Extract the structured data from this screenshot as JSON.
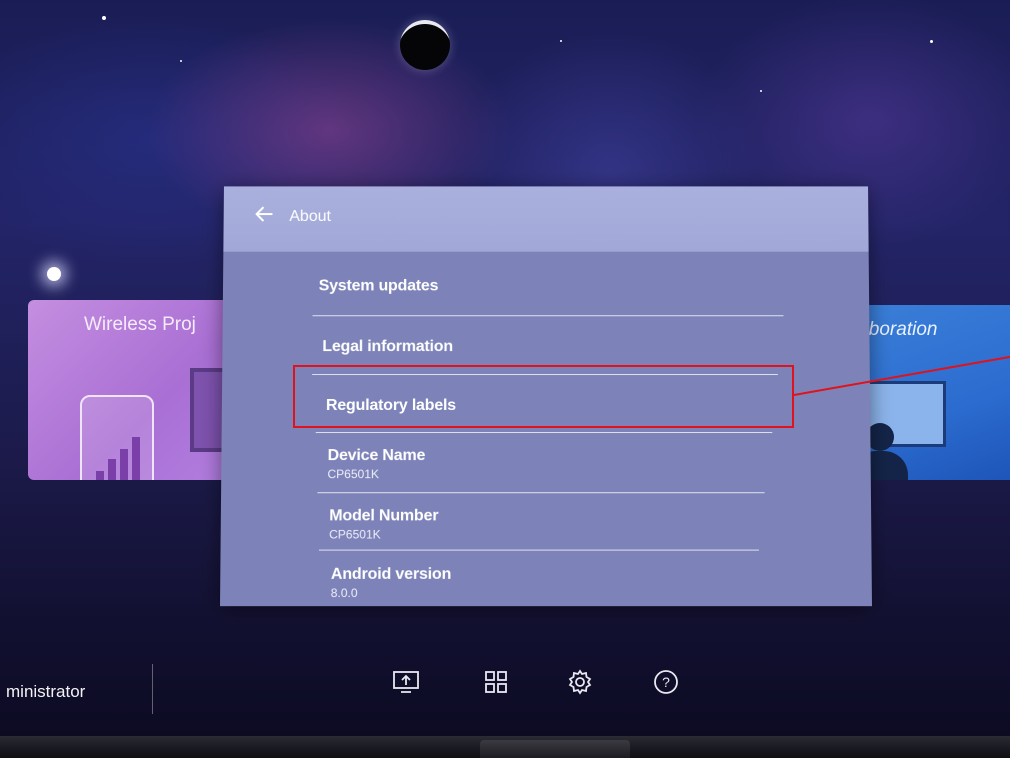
{
  "background_cards": {
    "left_title": "Wireless Proj",
    "right_title": "laboration"
  },
  "dialog": {
    "back_icon": "arrow-left-icon",
    "title": "About",
    "items": [
      {
        "label": "System updates",
        "value": ""
      },
      {
        "label": "Legal information",
        "value": ""
      },
      {
        "label": "Regulatory labels",
        "value": ""
      },
      {
        "label": "Device Name",
        "value": "CP6501K"
      },
      {
        "label": "Model Number",
        "value": "CP6501K"
      },
      {
        "label": "Android version",
        "value": "8.0.0"
      }
    ]
  },
  "annotation": {
    "color": "#e0121b",
    "highlighted_item": "Regulatory labels"
  },
  "taskbar": {
    "user_label": "ministrator",
    "icons": [
      "screen-share-icon",
      "apps-grid-icon",
      "settings-gear-icon",
      "help-icon"
    ]
  }
}
